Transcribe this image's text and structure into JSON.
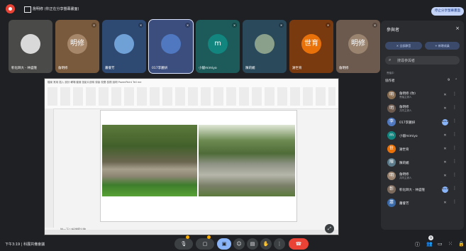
{
  "topbar": {
    "presenter_text": "詹明修 (你正在分享螢幕畫面)",
    "stop_label": "停止分享螢幕畫面"
  },
  "tiles": [
    {
      "name": "彰化師大 - 林盛隆",
      "avatar_text": "",
      "color": "#4a4a48",
      "av_color": "#d9d9d9"
    },
    {
      "name": "詹明修",
      "avatar_text": "明修",
      "color": "#7a5a3c",
      "av_color": "#a7876a"
    },
    {
      "name": "蕭睿芳",
      "avatar_text": "",
      "color": "#2f4a72",
      "av_color": "#6fa0d6"
    },
    {
      "name": "017李麗妍",
      "avatar_text": "",
      "color": "#3b4e7e",
      "av_color": "#4f78c0"
    },
    {
      "name": "小貓mimiyo",
      "avatar_text": "m",
      "color": "#1d5a5a",
      "av_color": "#11857e"
    },
    {
      "name": "陳莉媚",
      "avatar_text": "",
      "color": "#2a4a5c",
      "av_color": "#8aa08a"
    },
    {
      "name": "謝世育",
      "avatar_text": "世育",
      "color": "#7a3a10",
      "av_color": "#e8710a"
    },
    {
      "name": "詹明修",
      "avatar_text": "明修",
      "color": "#6d5a4e",
      "av_color": "#9a8470"
    }
  ],
  "share": {
    "ribbon_tabs": "檔案  常用  插入  設計  轉場  動畫  投影片放映  錄製  校閱  檢視  說明  PowerPoint  Tell me",
    "notes_text": "按一下以新增備忘稿"
  },
  "panel": {
    "title": "參與者",
    "close": "×",
    "btn_mute_all": "全部靜音",
    "btn_add": "新增成員",
    "search_placeholder": "搜尋參與者",
    "section_label": "會議中",
    "group_label": "協作者",
    "group_count": "9"
  },
  "participants": [
    {
      "name": "詹明修 (你)",
      "sub": "會議主辦人",
      "initial": "明",
      "color": "#8a6e52",
      "mic": "muted"
    },
    {
      "name": "詹明修",
      "sub": "共同主辦人",
      "initial": "明",
      "color": "#6d5a4e",
      "mic": "muted"
    },
    {
      "name": "017李麗妍",
      "sub": "",
      "initial": "李",
      "color": "#4f78c0",
      "mic": "active"
    },
    {
      "name": "小貓mimiyo",
      "sub": "",
      "initial": "m",
      "color": "#11857e",
      "mic": "muted"
    },
    {
      "name": "謝世育",
      "sub": "",
      "initial": "世",
      "color": "#e8710a",
      "mic": "muted"
    },
    {
      "name": "陳莉媚",
      "sub": "",
      "initial": "陳",
      "color": "#5b7a8a",
      "mic": "muted"
    },
    {
      "name": "詹明修",
      "sub": "共同主辦人",
      "initial": "明",
      "color": "#9a8470",
      "mic": "muted"
    },
    {
      "name": "彰化師大 - 林盛隆",
      "sub": "",
      "initial": "彰",
      "color": "#7c6a5c",
      "mic": "active"
    },
    {
      "name": "蕭睿芳",
      "sub": "",
      "initial": "蕭",
      "color": "#3b6aa8",
      "mic": "muted"
    }
  ],
  "bottombar": {
    "time_title": "下午3:19 | 科展共備會議",
    "raise_badge": "9"
  }
}
